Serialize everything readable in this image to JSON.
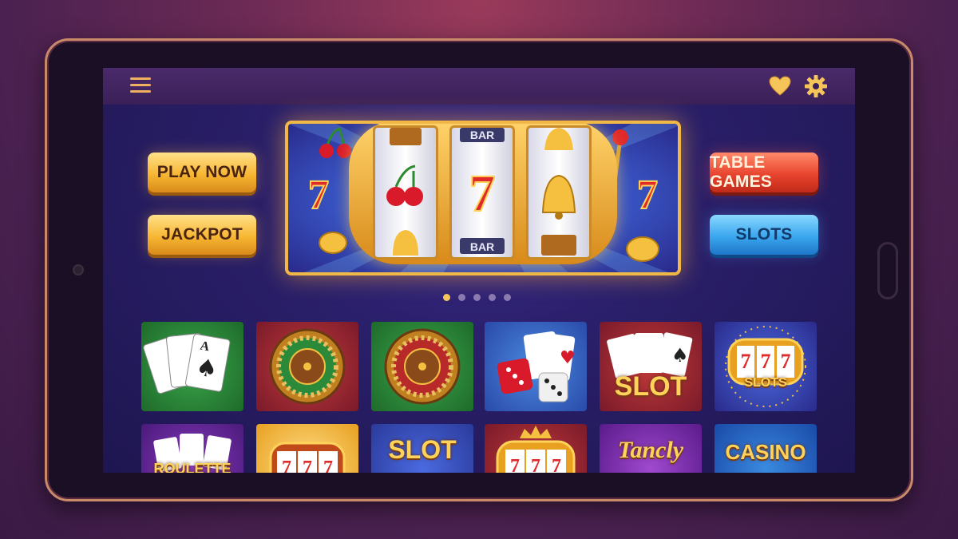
{
  "app": {
    "icons": {
      "menu": "hamburger-menu-icon",
      "favorite": "heart-icon",
      "settings": "gear-icon"
    },
    "colors": {
      "accent": "#f5c55a",
      "primary_gold": "#f7b733",
      "red": "#e8452e",
      "blue": "#3aa6ee"
    }
  },
  "hero": {
    "buttons_left": [
      {
        "label": "PLAY NOW"
      },
      {
        "label": "JACKPOT"
      }
    ],
    "buttons_right": [
      {
        "label": "TABLE GAMES"
      },
      {
        "label": "SLOTS"
      }
    ],
    "slot": {
      "reels": [
        {
          "top": "chest",
          "middle": "cherries",
          "bottom": "bell"
        },
        {
          "top": "BAR",
          "middle": "7",
          "bottom": "BAR"
        },
        {
          "top": "bell",
          "middle": "bell",
          "bottom": "chest"
        }
      ],
      "side_symbols": [
        "7",
        "7"
      ]
    },
    "carousel": {
      "count": 5,
      "active_index": 0
    }
  },
  "games": [
    {
      "label": ""
    },
    {
      "label": ""
    },
    {
      "label": ""
    },
    {
      "label": ""
    },
    {
      "label": "SLOT"
    },
    {
      "label": "SLOTS",
      "reel": "777"
    },
    {
      "label": "ROULETTE"
    },
    {
      "label": "",
      "reel": "777"
    },
    {
      "label": "SLOT"
    },
    {
      "label": "",
      "reel": "777"
    },
    {
      "label": "Tancly"
    },
    {
      "label": "CASINO"
    }
  ]
}
